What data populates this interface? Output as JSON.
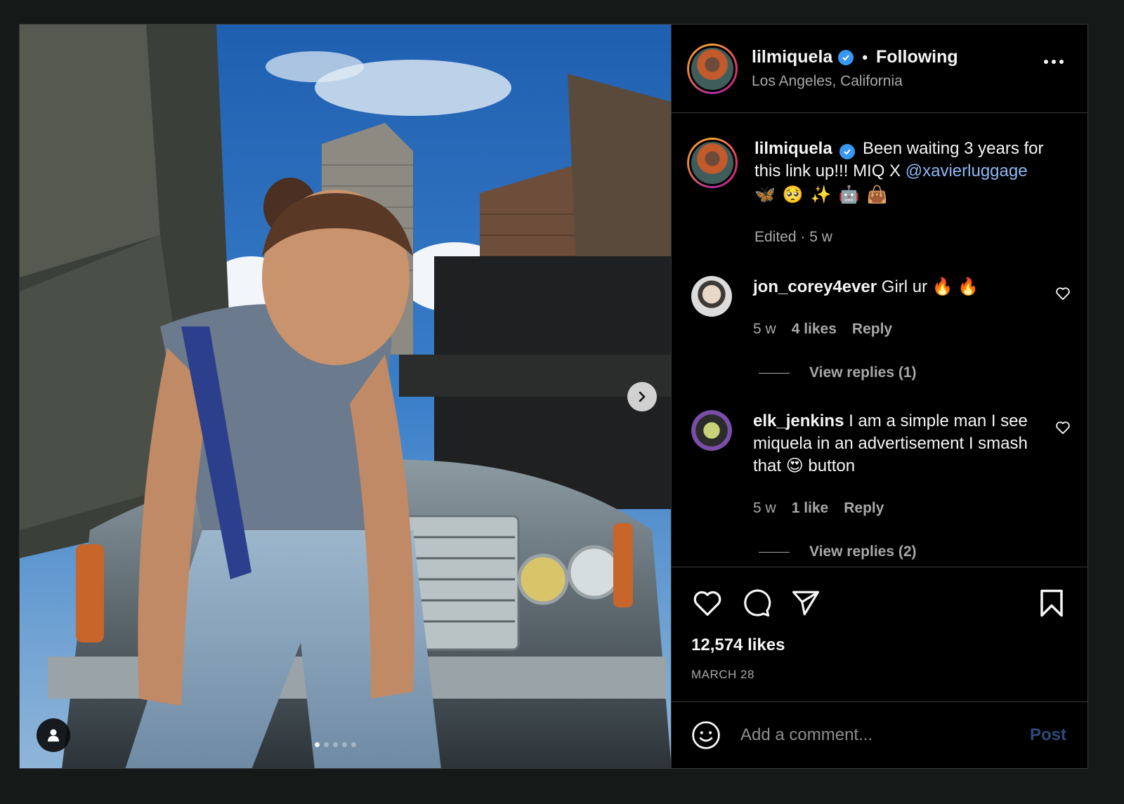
{
  "header": {
    "username": "lilmiquela",
    "separator": "•",
    "follow_status": "Following",
    "location": "Los Angeles, California"
  },
  "caption": {
    "username": "lilmiquela",
    "text": "Been waiting 3 years for this link up!!! MIQ X",
    "mention": "@xavierluggage",
    "emojis": [
      "🦋",
      "🥺",
      "✨",
      "🤖",
      "👜"
    ],
    "meta": "Edited · 5 w"
  },
  "comments": [
    {
      "username": "jon_corey4ever",
      "text": "Girl ur 🔥 🔥",
      "time": "5 w",
      "likes": "4 likes",
      "reply": "Reply",
      "view_replies": "View replies (1)"
    },
    {
      "username": "elk_jenkins",
      "text": "I am a simple man I see miquela in an advertisement I smash that 😍 button",
      "time": "5 w",
      "likes": "1 like",
      "reply": "Reply",
      "view_replies": "View replies (2)"
    }
  ],
  "post": {
    "likes": "12,574 likes",
    "date": "MARCH 28"
  },
  "composer": {
    "placeholder": "Add a comment...",
    "post_label": "Post"
  },
  "icons": {
    "like": "heart-icon",
    "comment": "comment-bubble-icon",
    "share": "paper-plane-icon",
    "save": "bookmark-icon",
    "emoji": "smiley-icon",
    "next": "chevron-right-icon",
    "tags": "user-tag-icon",
    "more": "more-options-icon"
  },
  "colors": {
    "background": "#000000",
    "mention": "#8fb8f5",
    "verified": "#3897f0",
    "post_button_disabled": "#2b4a7a"
  }
}
